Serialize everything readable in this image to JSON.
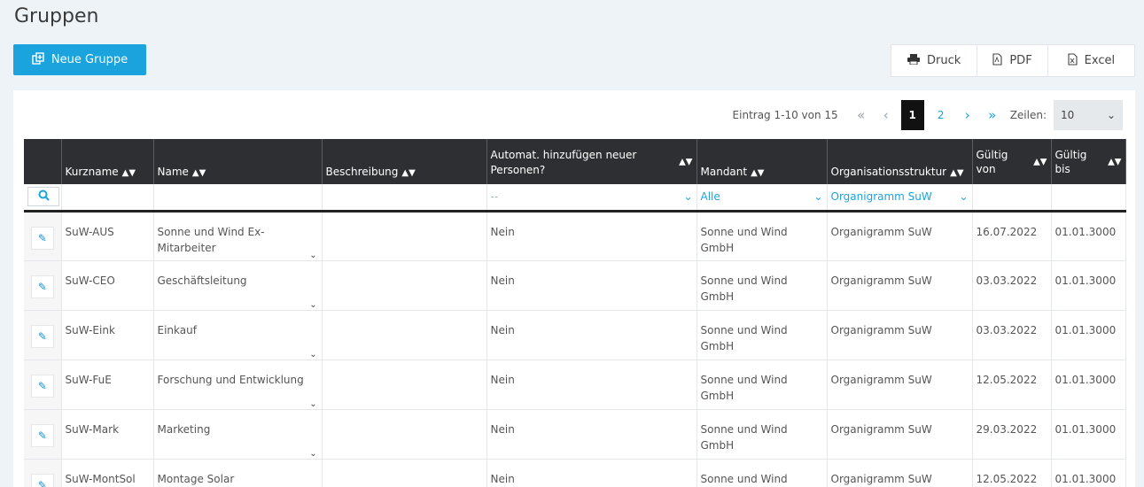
{
  "page": {
    "title": "Gruppen"
  },
  "toolbar": {
    "new_label": "Neue Gruppe",
    "export": {
      "druck": "Druck",
      "pdf": "PDF",
      "excel": "Excel"
    }
  },
  "pager": {
    "info": "Eintrag 1-10 von 15",
    "first": "«",
    "prev": "‹",
    "page1": "1",
    "page2": "2",
    "next": "›",
    "last": "»",
    "rows_label": "Zeilen:",
    "rows_value": "10"
  },
  "table": {
    "headers": {
      "kurzname": "Kurzname",
      "name": "Name",
      "beschreibung": "Beschreibung",
      "automat": "Automat. hinzufügen neuer Personen?",
      "mandant": "Mandant",
      "org": "Organisationsstruktur",
      "gueltig_von": "Gültig von",
      "gueltig_bis": "Gültig bis"
    },
    "filters": {
      "automat": "--",
      "mandant": "Alle",
      "org": "Organigramm SuW"
    },
    "rows": [
      {
        "kurzname": "SuW-AUS",
        "name": "Sonne und Wind Ex-Mitarbeiter",
        "automat": "Nein",
        "mandant": "Sonne und Wind GmbH",
        "org": "Organigramm SuW",
        "von": "16.07.2022",
        "bis": "01.01.3000"
      },
      {
        "kurzname": "SuW-CEO",
        "name": "Geschäftsleitung",
        "automat": "Nein",
        "mandant": "Sonne und Wind GmbH",
        "org": "Organigramm SuW",
        "von": "03.03.2022",
        "bis": "01.01.3000"
      },
      {
        "kurzname": "SuW-Eink",
        "name": "Einkauf",
        "automat": "Nein",
        "mandant": "Sonne und Wind GmbH",
        "org": "Organigramm SuW",
        "von": "03.03.2022",
        "bis": "01.01.3000"
      },
      {
        "kurzname": "SuW-FuE",
        "name": "Forschung und Entwicklung",
        "automat": "Nein",
        "mandant": "Sonne und Wind GmbH",
        "org": "Organigramm SuW",
        "von": "12.05.2022",
        "bis": "01.01.3000"
      },
      {
        "kurzname": "SuW-Mark",
        "name": "Marketing",
        "automat": "Nein",
        "mandant": "Sonne und Wind GmbH",
        "org": "Organigramm SuW",
        "von": "29.03.2022",
        "bis": "01.01.3000"
      },
      {
        "kurzname": "SuW-MontSol",
        "name": "Montage Solar",
        "automat": "Nein",
        "mandant": "Sonne und Wind",
        "org": "Organigramm SuW",
        "von": "12.05.2022",
        "bis": "01.01.3000"
      }
    ]
  },
  "colors": {
    "accent": "#1aa3dd",
    "header_bg": "#2d2f32",
    "page_bg": "#eef3f8"
  }
}
